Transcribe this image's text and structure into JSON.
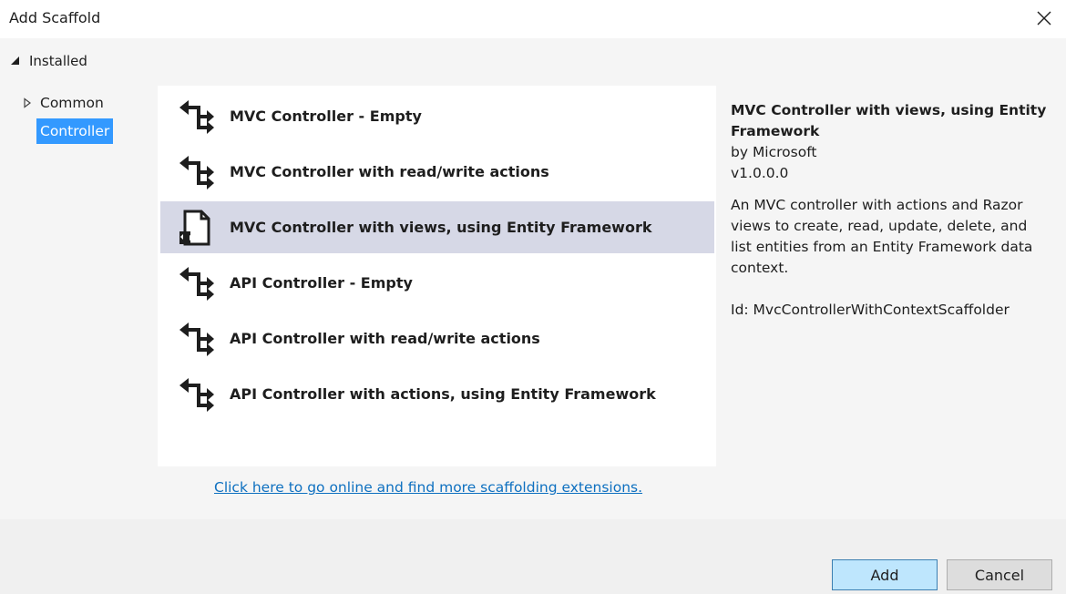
{
  "window": {
    "title": "Add Scaffold",
    "close_icon": "close-icon"
  },
  "tree": {
    "root_label": "Installed",
    "items": [
      {
        "label": "Common",
        "expandable": true
      },
      {
        "label": "Controller",
        "selected": true
      }
    ]
  },
  "templates": [
    {
      "label": "MVC Controller - Empty",
      "icon": "controller-icon"
    },
    {
      "label": "MVC Controller with read/write actions",
      "icon": "controller-icon"
    },
    {
      "label": "MVC Controller with views, using Entity Framework",
      "icon": "view-page-icon",
      "selected": true
    },
    {
      "label": "API Controller - Empty",
      "icon": "controller-icon"
    },
    {
      "label": "API Controller with read/write actions",
      "icon": "controller-icon"
    },
    {
      "label": "API Controller with actions, using Entity Framework",
      "icon": "controller-icon"
    }
  ],
  "details": {
    "title": "MVC Controller with views, using Entity Framework",
    "author": "by Microsoft",
    "version": "v1.0.0.0",
    "description": "An MVC controller with actions and Razor views to create, read, update, delete, and list entities from an Entity Framework data context.",
    "id": "Id: MvcControllerWithContextScaffolder"
  },
  "online_link": "Click here to go online and find more scaffolding extensions.",
  "buttons": {
    "add": "Add",
    "cancel": "Cancel"
  },
  "colors": {
    "selection_tree": "#3399ff",
    "selection_list": "#d6d8e6",
    "link": "#0e70c0",
    "add_button_bg": "#bee6fd"
  }
}
